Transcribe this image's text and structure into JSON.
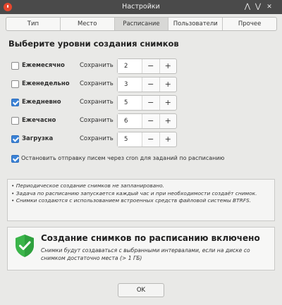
{
  "window": {
    "title": "Настройки"
  },
  "tabs": [
    {
      "label": "Тип"
    },
    {
      "label": "Место"
    },
    {
      "label": "Расписание",
      "active": true
    },
    {
      "label": "Пользователи"
    },
    {
      "label": "Прочее"
    }
  ],
  "schedule": {
    "heading": "Выберите уровни создания снимков",
    "keep_label": "Сохранить",
    "levels": [
      {
        "label": "Ежемесячно",
        "checked": false,
        "keep": "2"
      },
      {
        "label": "Еженедельно",
        "checked": false,
        "keep": "3"
      },
      {
        "label": "Ежедневно",
        "checked": true,
        "keep": "5"
      },
      {
        "label": "Ежечасно",
        "checked": false,
        "keep": "6"
      },
      {
        "label": "Загрузка",
        "checked": true,
        "keep": "5"
      }
    ],
    "cron_option": {
      "label": "Остановить отправку писем через cron для заданий по расписанию",
      "checked": true
    }
  },
  "notes": [
    "• Периодическое создание снимков не запланировано.",
    "• Задача по расписанию запускается каждый час и при необходимости создаёт снимок.",
    "• Снимки создаются с использованием встроенных средств файловой системы BTRFS."
  ],
  "status": {
    "title": "Создание снимков по расписанию включено",
    "description": "Снимки будут создаваться с выбранными интервалами, если на диске со снимком достаточно места (> 1 ГБ)",
    "icon": "shield-check-icon",
    "color": "#3bb54a"
  },
  "buttons": {
    "ok": "OK"
  },
  "colors": {
    "accent": "#3a82d6",
    "titlebar": "#4a4a4a",
    "close": "#e5462d"
  }
}
